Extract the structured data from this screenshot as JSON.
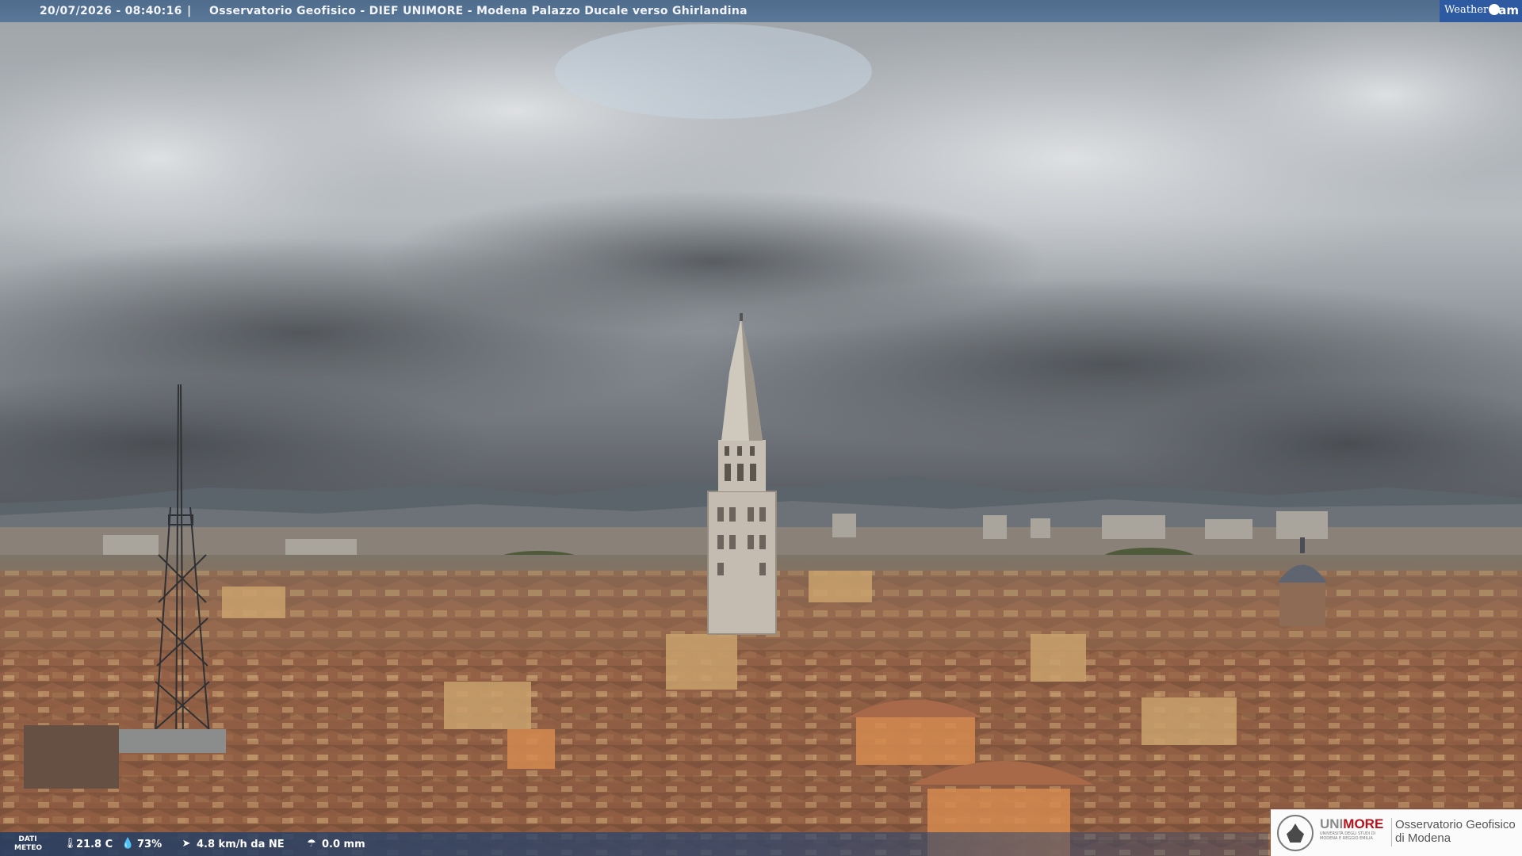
{
  "top_bar": {
    "timestamp": "20/07/2026 - 08:40:16",
    "separator": "|",
    "location": "Osservatorio Geofisico - DIEF UNIMORE - Modena Palazzo Ducale verso Ghirlandina",
    "logo_text_left": "Weather",
    "logo_text_right": "Cam"
  },
  "bottom_bar": {
    "label": "DATI METEO",
    "temperature": "21.8 C",
    "humidity": "73%",
    "wind": "4.8 km/h da NE",
    "rain": "0.0 mm",
    "icons": [
      "thermometer-icon",
      "humidity-drop-icon",
      "wind-vane-icon",
      "rain-gauge-icon"
    ]
  },
  "logo_box": {
    "brand_prefix": "UNI",
    "brand_suffix": "MORE",
    "brand_subtitle": "UNIVERSITÀ DEGLI STUDI DI MODENA E REGGIO EMILIA",
    "title_line1": "Osservatorio Geofisico",
    "title_line2": "di Modena"
  },
  "colors": {
    "top_bar": "#5a7898",
    "bottom_bar": "#2e466c",
    "accent_red": "#b5121b",
    "weathercam_blue": "#2d5aa0"
  }
}
